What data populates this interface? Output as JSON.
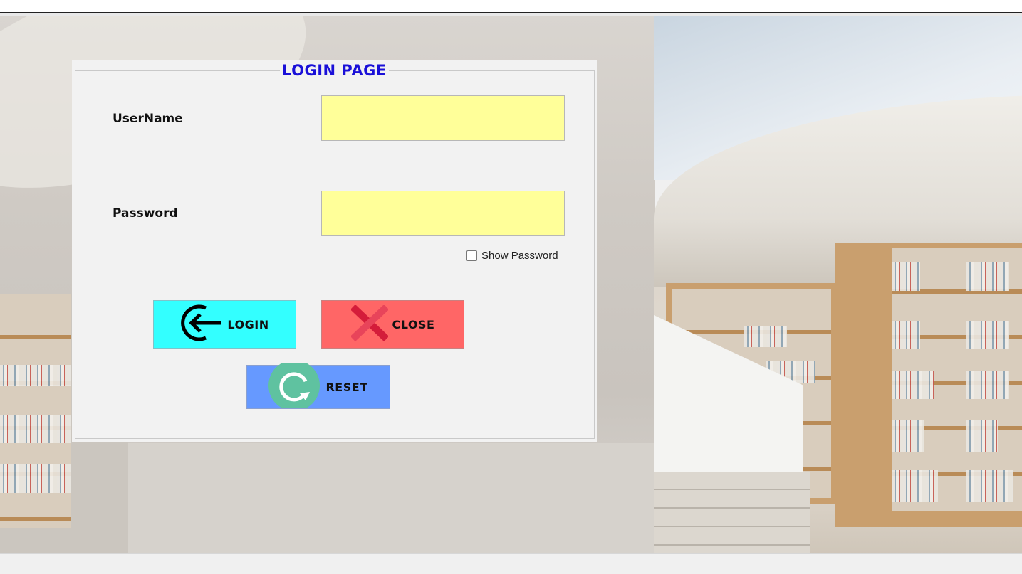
{
  "form": {
    "title": "LOGIN PAGE",
    "username_label": "UserName",
    "username_value": "",
    "password_label": "Password",
    "password_value": "",
    "show_password_label": "Show Password",
    "show_password_checked": false
  },
  "buttons": {
    "login_label": "LOGIN",
    "close_label": "CLOSE",
    "reset_label": "RESET"
  },
  "colors": {
    "title": "#1a10d8",
    "field_bg": "#ffff99",
    "login_bg": "#33ffff",
    "close_bg": "#ff6666",
    "reset_bg": "#6699ff"
  },
  "icons": {
    "login": "login-arrow-icon",
    "close": "red-x-icon",
    "reset": "refresh-icon"
  }
}
